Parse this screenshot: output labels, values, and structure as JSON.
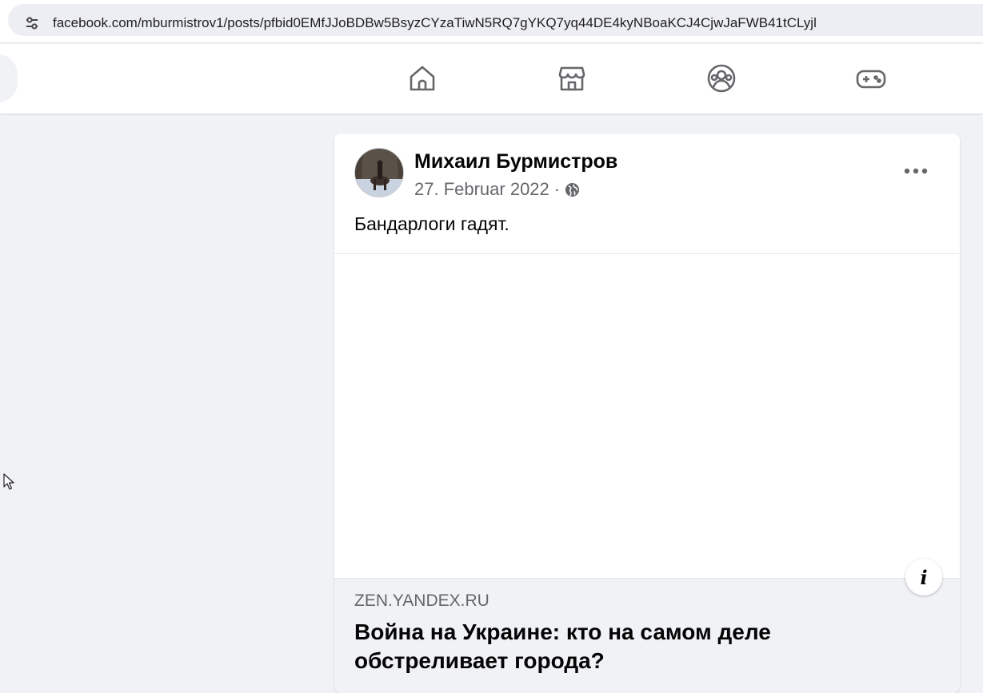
{
  "browser": {
    "url": "facebook.com/mburmistrov1/posts/pfbid0EMfJJoBDBw5BsyzCYzaTiwN5RQ7gYKQ7yq44DE4kyNBoaKCJ4CjwJaFWB41tCLyjl",
    "site_info_icon": "tune-icon"
  },
  "nav": {
    "icons": [
      "home-icon",
      "marketplace-icon",
      "groups-icon",
      "gaming-icon"
    ]
  },
  "post": {
    "author": "Михаил Бурмистров",
    "date": "27. Februar 2022",
    "separator": "·",
    "audience_icon": "globe-icon",
    "text": "Бандарлоги гадят.",
    "link": {
      "domain": "ZEN.YANDEX.RU",
      "title": "Война на Украине: кто на самом деле обстреливает города?"
    },
    "info_label": "i"
  },
  "colors": {
    "background": "#f0f2f5",
    "card": "#ffffff",
    "secondary_text": "#65676b",
    "icon": "#65676b"
  }
}
